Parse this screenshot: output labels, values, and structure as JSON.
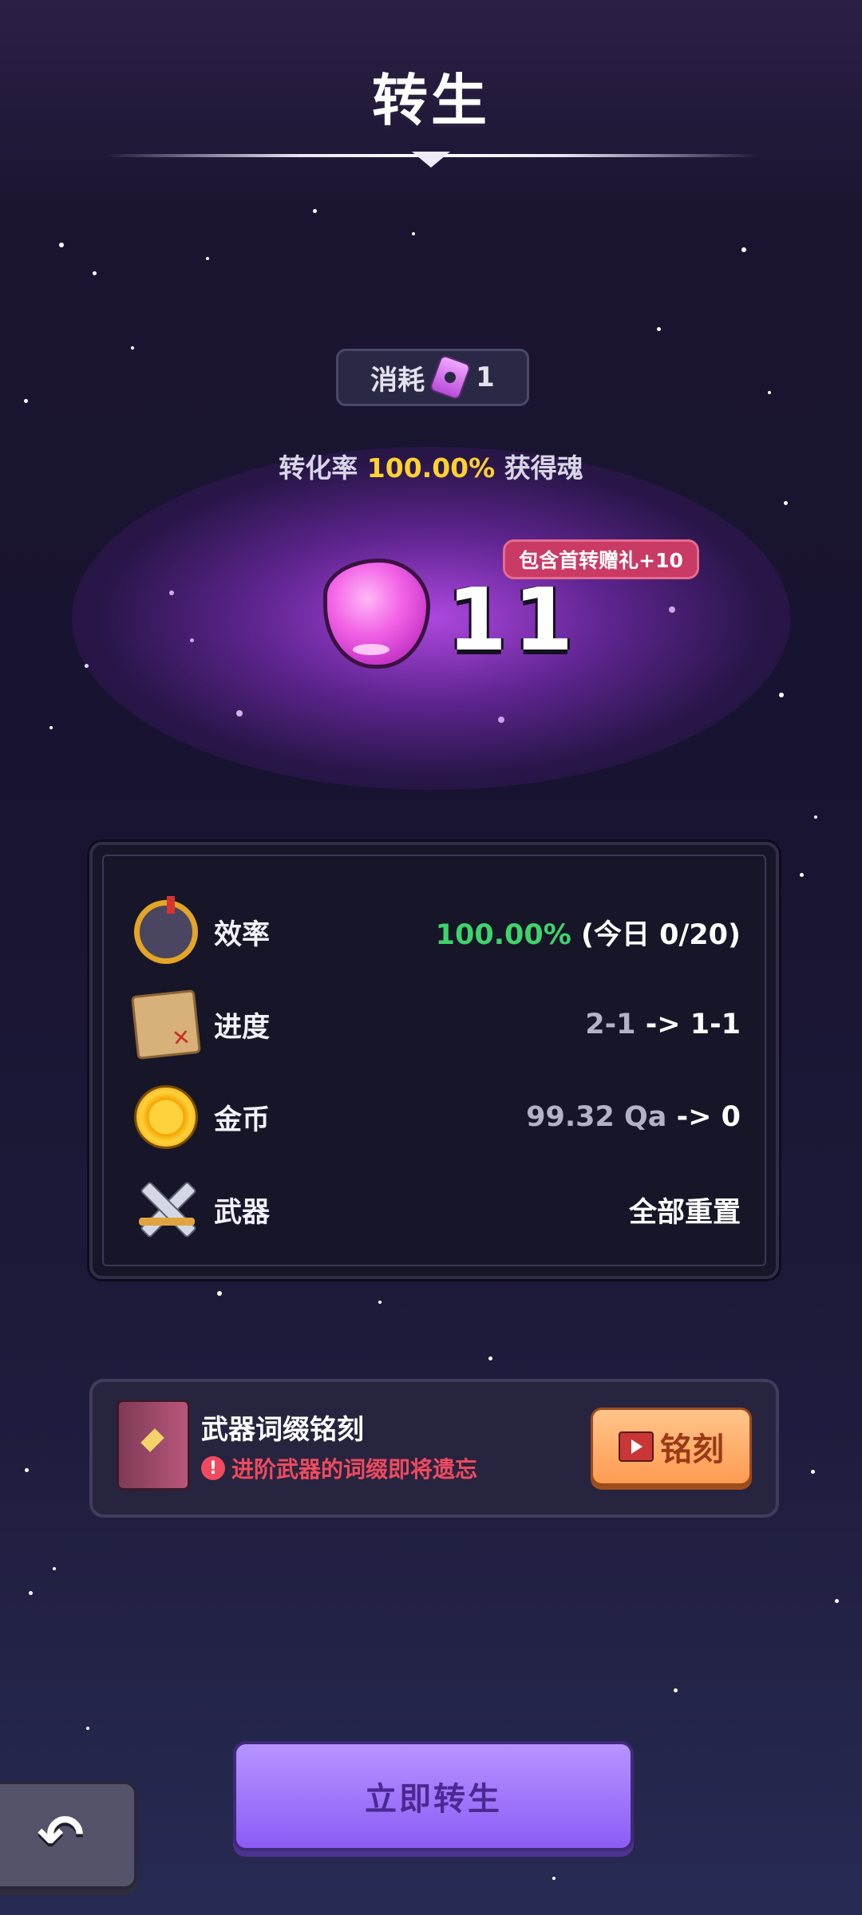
{
  "header": {
    "title": "转生"
  },
  "cost": {
    "label": "消耗",
    "amount": "1",
    "icon": "soul-jar-icon"
  },
  "conversion": {
    "prefix": "转化率",
    "rate": "100.00%",
    "suffix": "获得魂"
  },
  "reward": {
    "bonus_badge": "包含首转赠礼+10",
    "soul_count": "11",
    "icon": "soul-droplet-icon"
  },
  "stats": [
    {
      "label": "效率",
      "value_main": "100.00%",
      "value_extra": "(今日 0/20)",
      "icon": "efficiency-gauge-icon"
    },
    {
      "label": "进度",
      "value_from": "2-1",
      "value_to": "-> 1-1",
      "icon": "treasure-map-icon"
    },
    {
      "label": "金币",
      "value_from": "99.32 Qa",
      "value_to": "-> 0",
      "icon": "gold-coin-icon"
    },
    {
      "label": "武器",
      "value": "全部重置",
      "icon": "crossed-swords-icon"
    }
  ],
  "engrave": {
    "title": "武器词缀铭刻",
    "warning": "进阶武器的词缀即将遗忘",
    "button_label": "铭刻"
  },
  "actions": {
    "rebirth_label": "立即转生",
    "back_icon": "back-arrow-icon"
  },
  "colors": {
    "accent_yellow": "#ffd22e",
    "accent_green": "#3ed46b",
    "warning_red": "#f04a5f",
    "button_purple": "#8b5cf6"
  }
}
